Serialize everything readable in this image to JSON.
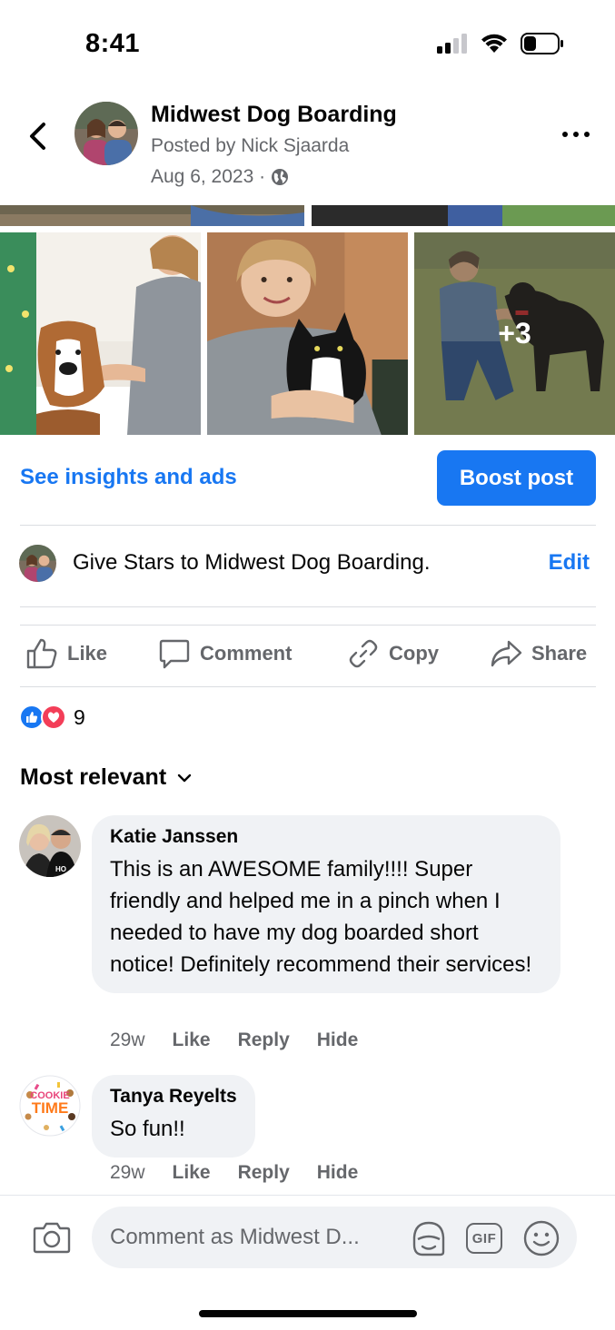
{
  "status_bar": {
    "time": "8:41"
  },
  "post": {
    "page_name": "Midwest Dog Boarding",
    "posted_by": "Posted by Nick Sjaarda",
    "date": "Aug 6, 2023 ·",
    "photos_more_count": "+3"
  },
  "insights": {
    "link_label": "See insights and ads",
    "boost_label": "Boost post"
  },
  "stars": {
    "text": "Give Stars to Midwest Dog Boarding.",
    "edit_label": "Edit"
  },
  "actions": {
    "like": "Like",
    "comment": "Comment",
    "copy": "Copy",
    "share": "Share"
  },
  "reactions": {
    "count": "9"
  },
  "comments_sort": {
    "label": "Most relevant"
  },
  "comments": [
    {
      "author": "Katie Janssen",
      "text": "This is an AWESOME family!!!! Super friendly and helped me in a pinch when I needed to have my dog boarded short notice! Definitely recommend their services!",
      "time": "29w",
      "like": "Like",
      "reply": "Reply",
      "hide": "Hide"
    },
    {
      "author": "Tanya Reyelts",
      "text": "So fun!!",
      "time": "29w",
      "like": "Like",
      "reply": "Reply",
      "hide": "Hide",
      "avatar_text_1": "COOKIE",
      "avatar_text_2": "TIME"
    }
  ],
  "composer": {
    "placeholder": "Comment as Midwest D...",
    "gif_label": "GIF"
  },
  "colors": {
    "accent": "#1877f2",
    "secondary_text": "#65676b",
    "bubble_bg": "#f0f2f5",
    "love_red": "#f33e58"
  }
}
